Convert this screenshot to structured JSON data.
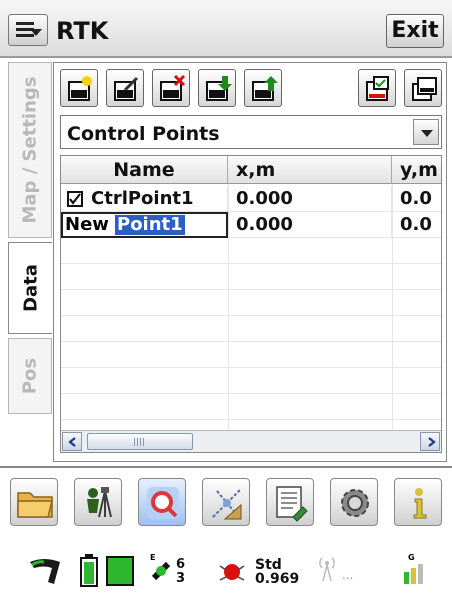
{
  "header": {
    "title": "RTK",
    "exit_label": "Exit"
  },
  "tabs": [
    {
      "label": "Map / Settings",
      "active": false
    },
    {
      "label": "Data",
      "active": true
    },
    {
      "label": "Pos",
      "active": false
    }
  ],
  "toolbar": {
    "buttons": [
      "new-point-icon",
      "edit-point-icon",
      "delete-point-icon",
      "import-icon",
      "export-icon",
      "select-all-icon",
      "copy-icon"
    ]
  },
  "dropdown": {
    "selected": "Control Points"
  },
  "table": {
    "columns": [
      "Name",
      "x,m",
      "y,m"
    ],
    "rows": [
      {
        "checked": true,
        "name": "CtrlPoint1",
        "x": "0.000",
        "y": "0.0"
      },
      {
        "editing": true,
        "prefix": "New",
        "selected_text": "Point1",
        "x": "0.000",
        "y": "0.0"
      }
    ]
  },
  "launcher": {
    "icons": [
      "folder-icon",
      "survey-icon",
      "search-icon",
      "cogo-icon",
      "notes-icon",
      "settings-icon",
      "info-icon"
    ]
  },
  "status": {
    "satellites_e": "6",
    "satellites_g": "3",
    "solution_label": "Std",
    "solution_value": "0.969",
    "radio_text": "..."
  },
  "colors": {
    "selection": "#2b5ec7",
    "accent_green": "#2eb82e",
    "status_red": "#d81010"
  }
}
